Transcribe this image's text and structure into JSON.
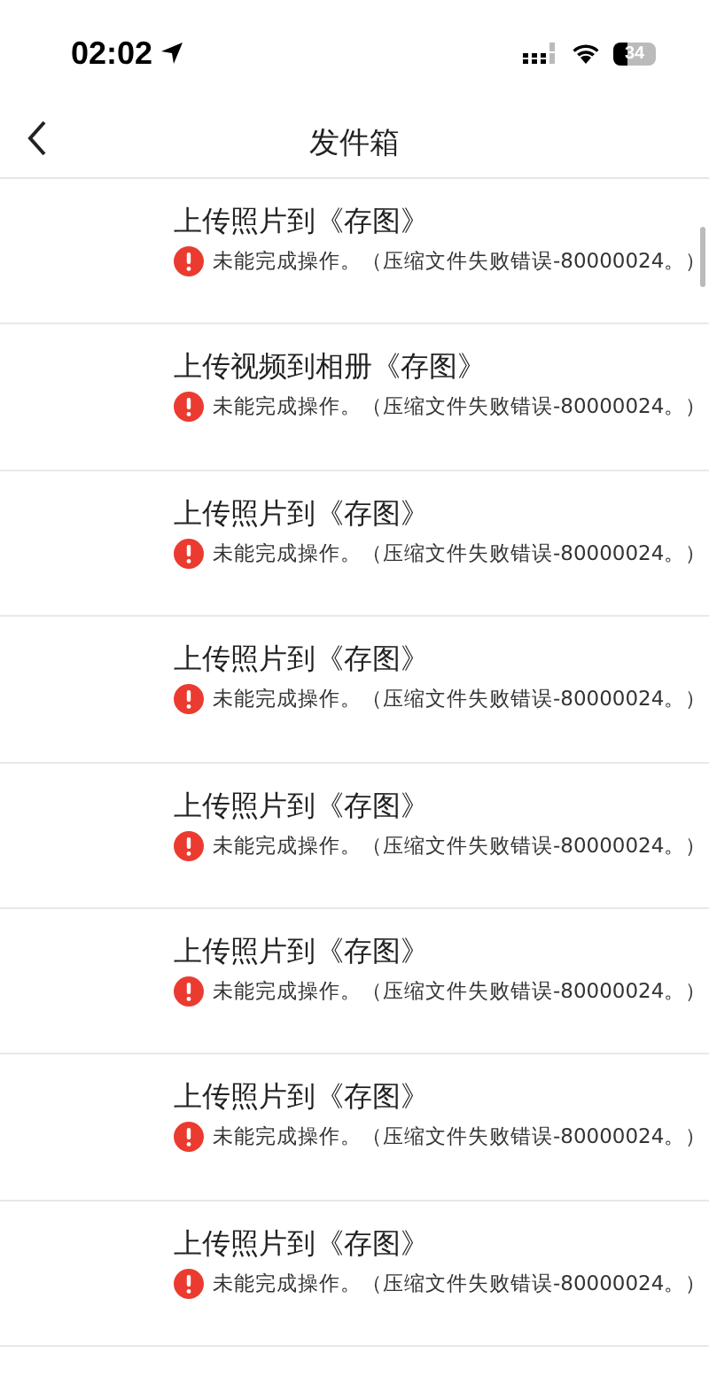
{
  "status_bar": {
    "time": "02:02",
    "battery": "34"
  },
  "nav_bar": {
    "title": "发件箱"
  },
  "items": [
    {
      "title": "上传照片到《存图》",
      "error": "未能完成操作。（压缩文件失败错误-80000024。）"
    },
    {
      "title": "上传视频到相册《存图》",
      "error": "未能完成操作。（压缩文件失败错误-80000024。）"
    },
    {
      "title": "上传照片到《存图》",
      "error": "未能完成操作。（压缩文件失败错误-80000024。）"
    },
    {
      "title": "上传照片到《存图》",
      "error": "未能完成操作。（压缩文件失败错误-80000024。）"
    },
    {
      "title": "上传照片到《存图》",
      "error": "未能完成操作。（压缩文件失败错误-80000024。）"
    },
    {
      "title": "上传照片到《存图》",
      "error": "未能完成操作。（压缩文件失败错误-80000024。）"
    },
    {
      "title": "上传照片到《存图》",
      "error": "未能完成操作。（压缩文件失败错误-80000024。）"
    },
    {
      "title": "上传照片到《存图》",
      "error": "未能完成操作。（压缩文件失败错误-80000024。）"
    }
  ]
}
